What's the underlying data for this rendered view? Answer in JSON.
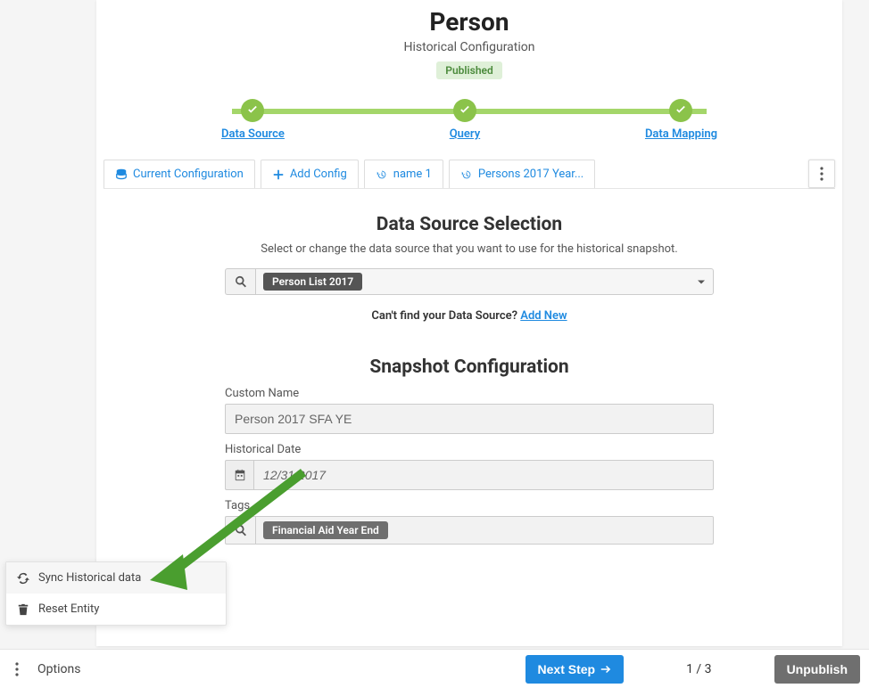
{
  "header": {
    "title": "Person",
    "subtitle": "Historical Configuration",
    "status": "Published"
  },
  "stepper": {
    "steps": [
      "Data Source",
      "Query",
      "Data Mapping"
    ]
  },
  "tabs": {
    "items": [
      {
        "icon": "database",
        "label": "Current Configuration"
      },
      {
        "icon": "plus",
        "label": "Add Config"
      },
      {
        "icon": "history",
        "label": "name 1"
      },
      {
        "icon": "history",
        "label": "Persons 2017 Year..."
      }
    ]
  },
  "data_source": {
    "title": "Data Source Selection",
    "subtitle": "Select or change the data source that you want to use for the historical snapshot.",
    "selected": "Person List 2017",
    "cant_find_text": "Can't find your Data Source? ",
    "add_new": "Add New"
  },
  "snapshot": {
    "title": "Snapshot Configuration",
    "custom_name_label": "Custom Name",
    "custom_name_value": "Person 2017 SFA YE",
    "date_label": "Historical Date",
    "date_value": "12/31/2017",
    "tags_label": "Tags",
    "tag_value": "Financial Aid Year End"
  },
  "popup": {
    "sync": "Sync Historical data",
    "reset": "Reset Entity"
  },
  "footer": {
    "options": "Options",
    "next": "Next Step",
    "page": "1 / 3",
    "unpublish": "Unpublish"
  }
}
